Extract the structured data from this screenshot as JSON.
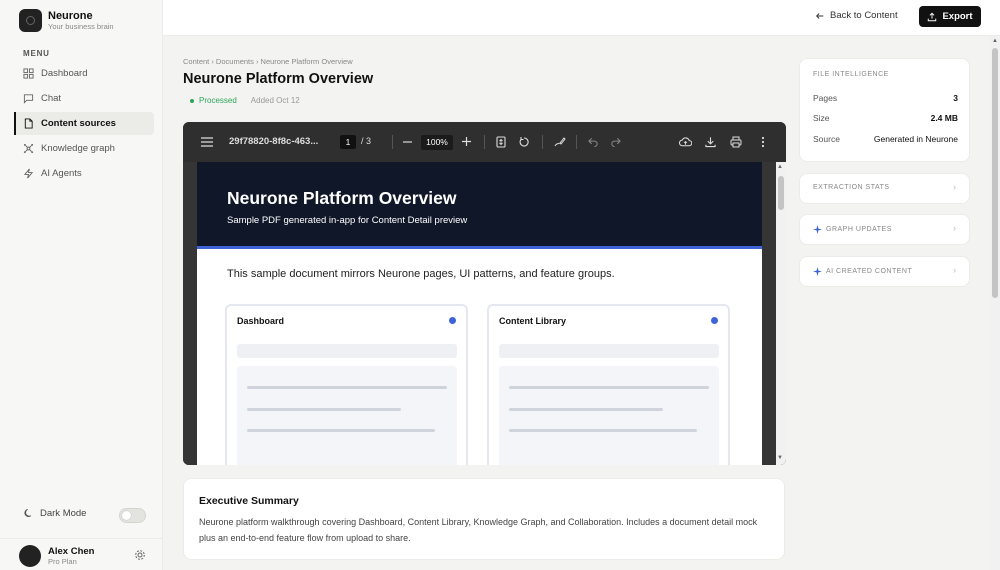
{
  "brand": {
    "name": "Neurone",
    "tagline": "Your business brain"
  },
  "sidebar": {
    "menu_label": "MENU",
    "items": [
      {
        "label": "Dashboard",
        "icon": "grid-icon"
      },
      {
        "label": "Chat",
        "icon": "chat-icon"
      },
      {
        "label": "Content sources",
        "icon": "file-icon",
        "active": true
      },
      {
        "label": "Knowledge graph",
        "icon": "graph-icon"
      },
      {
        "label": "AI Agents",
        "icon": "bolt-icon"
      }
    ],
    "dark_mode_label": "Dark Mode",
    "dark_mode_on": false
  },
  "user": {
    "name": "Alex Chen",
    "plan": "Pro Plan"
  },
  "topbar": {
    "back_label": "Back to Content",
    "export_label": "Export"
  },
  "breadcrumb": "Content › Documents › Neurone Platform Overview",
  "page": {
    "title": "Neurone Platform Overview",
    "status": "Processed",
    "added": "Added Oct 12"
  },
  "viewer": {
    "file_name": "29f78820-8f8c-463...",
    "page_current": "1",
    "page_total": "/ 3",
    "zoom": "100%",
    "pdf": {
      "title": "Neurone Platform Overview",
      "subtitle": "Sample PDF generated in-app for Content Detail preview",
      "intro": "This sample document mirrors Neurone pages, UI patterns, and feature groups.",
      "cards": [
        {
          "title": "Dashboard"
        },
        {
          "title": "Content Library"
        }
      ]
    }
  },
  "summary": {
    "title": "Executive Summary",
    "text": "Neurone platform walkthrough covering Dashboard, Content Library, Knowledge Graph, and Collaboration. Includes a document detail mock plus an end-to-end feature flow from upload to share."
  },
  "intel": {
    "heading": "FILE INTELLIGENCE",
    "rows": [
      {
        "label": "Pages",
        "value": "3"
      },
      {
        "label": "Size",
        "value": "2.4 MB"
      },
      {
        "label": "Source",
        "value": "Generated in Neurone"
      }
    ]
  },
  "panels": [
    {
      "label": "EXTRACTION STATS",
      "icon": ""
    },
    {
      "label": "GRAPH UPDATES",
      "icon": "sparkle-icon"
    },
    {
      "label": "AI CREATED CONTENT",
      "icon": "sparkle-icon"
    }
  ],
  "colors": {
    "accent": "#3d63d6",
    "hero": "#0f1729",
    "status": "#2fa45b",
    "primary_button": "#111111"
  }
}
